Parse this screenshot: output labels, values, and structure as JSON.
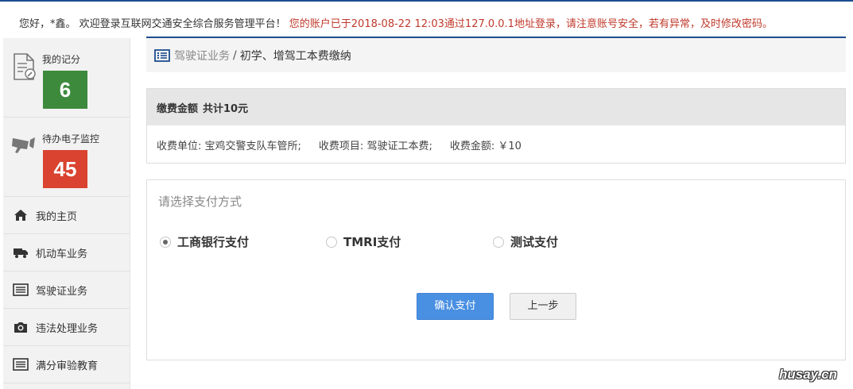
{
  "header": {
    "greeting": "您好，*鑫。 欢迎登录互联网交通安全综合服务管理平台！",
    "login_notice": "您的账户已于2018-08-22 12:03通过127.0.0.1地址登录，请注意账号安全，若有异常，及时修改密码。"
  },
  "sidebar": {
    "stats": [
      {
        "label": "我的记分",
        "value": "6",
        "color": "#3d8a3d",
        "icon": "document-edit-icon"
      },
      {
        "label": "待办电子监控",
        "value": "45",
        "color": "#d9432f",
        "icon": "camera-icon"
      }
    ],
    "items": [
      {
        "label": "我的主页",
        "icon": "home-icon"
      },
      {
        "label": "机动车业务",
        "icon": "truck-icon"
      },
      {
        "label": "驾驶证业务",
        "icon": "list-icon"
      },
      {
        "label": "违法处理业务",
        "icon": "camera-icon"
      },
      {
        "label": "满分审验教育",
        "icon": "list-icon"
      }
    ]
  },
  "breadcrumb": {
    "section": "驾驶证业务",
    "separator": "/",
    "current": "初学、增驾工本费缴纳"
  },
  "fee": {
    "title": "缴费金额",
    "total": "共计10元",
    "unit_label": "收费单位:",
    "unit_value": "宝鸡交警支队车管所;",
    "item_label": "收费项目:",
    "item_value": "驾驶证工本费;",
    "amount_label": "收费金额:",
    "amount_value": "￥10"
  },
  "payment": {
    "title": "请选择支付方式",
    "options": [
      {
        "label": "工商银行支付",
        "selected": true
      },
      {
        "label": "TMRI支付",
        "selected": false
      },
      {
        "label": "测试支付",
        "selected": false
      }
    ],
    "confirm_label": "确认支付",
    "back_label": "上一步"
  },
  "watermark": "husay.cn",
  "colors": {
    "accent": "#1d4e8f",
    "primary_button": "#4a90e2",
    "warning_text": "#c0392b"
  }
}
